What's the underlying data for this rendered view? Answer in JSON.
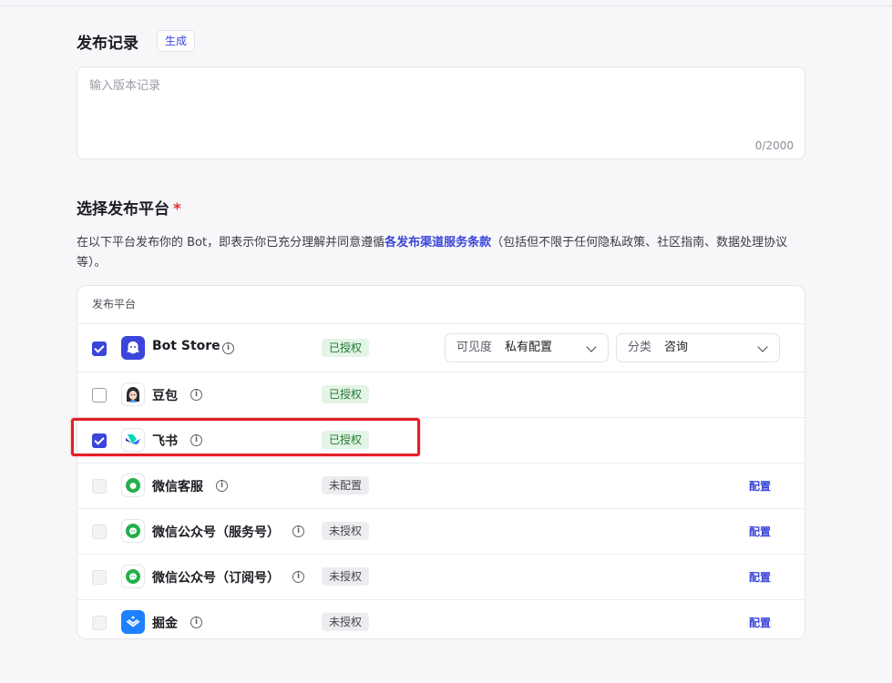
{
  "release_notes": {
    "title": "发布记录",
    "generate_label": "生成",
    "placeholder": "输入版本记录",
    "counter": "0/2000"
  },
  "platform_section": {
    "title": "选择发布平台",
    "required_mark": "*",
    "desc_before": "在以下平台发布你的 Bot，即表示你已充分理解并同意遵循",
    "desc_link": "各发布渠道服务条款",
    "desc_after": "（包括但不限于任何隐私政策、社区指南、数据处理协议等）。",
    "table_header": "发布平台"
  },
  "platforms": [
    {
      "name": "Bot Store",
      "status": "已授权",
      "checked": true,
      "disabled": false,
      "icon": "bot-store-icon",
      "visibility_label": "可见度",
      "visibility_value": "私有配置",
      "category_label": "分类",
      "category_value": "咨询"
    },
    {
      "name": "豆包",
      "status": "已授权",
      "checked": false,
      "disabled": false,
      "icon": "doubao-icon"
    },
    {
      "name": "飞书",
      "status": "已授权",
      "checked": true,
      "disabled": false,
      "icon": "feishu-icon"
    },
    {
      "name": "微信客服",
      "status": "未配置",
      "checked": false,
      "disabled": true,
      "icon": "wechat-icon",
      "action": "配置"
    },
    {
      "name": "微信公众号（服务号）",
      "status": "未授权",
      "checked": false,
      "disabled": true,
      "icon": "wechat-icon",
      "action": "配置"
    },
    {
      "name": "微信公众号（订阅号）",
      "status": "未授权",
      "checked": false,
      "disabled": true,
      "icon": "wechat-icon",
      "action": "配置"
    },
    {
      "name": "掘金",
      "status": "未授权",
      "checked": false,
      "disabled": true,
      "icon": "juejin-icon",
      "action": "配置"
    }
  ],
  "colors": {
    "accent": "#3b45d9",
    "highlight": "#e41e26",
    "authorized_bg": "#e4f4e6",
    "wechat": "#22b04b"
  }
}
